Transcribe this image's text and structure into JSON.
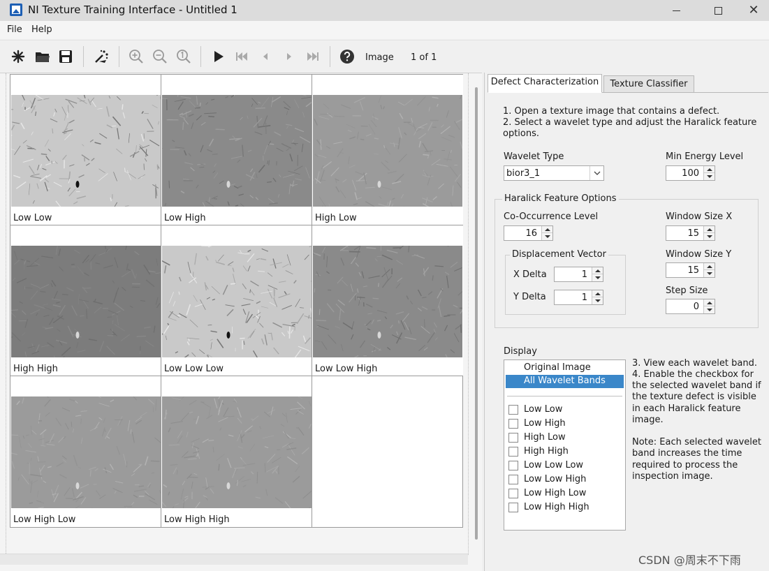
{
  "window": {
    "title": "NI Texture Training Interface - Untitled 1",
    "close_glyph": "✕"
  },
  "menu": {
    "file": "File",
    "help": "Help"
  },
  "toolbar": {
    "image_label": "Image",
    "page_indicator": "1  of   1",
    "icons": [
      "new-icon",
      "open-folder-icon",
      "save-icon",
      "magic-wand-icon",
      "zoom-in-icon",
      "zoom-out-icon",
      "zoom-fit-icon",
      "play-icon",
      "skip-first-icon",
      "step-back-icon",
      "step-forward-icon",
      "skip-last-icon",
      "help-icon"
    ]
  },
  "bands": [
    {
      "label": "Low Low",
      "tone": "light"
    },
    {
      "label": "Low High",
      "tone": "mid"
    },
    {
      "label": "High Low",
      "tone": "flat"
    },
    {
      "label": "High High",
      "tone": "dark"
    },
    {
      "label": "Low Low Low",
      "tone": "light"
    },
    {
      "label": "Low Low High",
      "tone": "mid"
    },
    {
      "label": "Low High Low",
      "tone": "flat"
    },
    {
      "label": "Low High High",
      "tone": "flat"
    }
  ],
  "tabs": {
    "defect": "Defect Characterization",
    "texture": "Texture Classifier"
  },
  "instructions": {
    "line1": "1. Open a texture image that contains a defect.",
    "line2": "2. Select a wavelet type and adjust the Haralick feature",
    "line3": "options."
  },
  "wavelet_type": {
    "label": "Wavelet Type",
    "value": "bior3_1"
  },
  "min_energy": {
    "label": "Min Energy Level",
    "value": "100"
  },
  "haralick": {
    "title": "Haralick Feature Options",
    "co_occurrence": {
      "label": "Co-Occurrence Level",
      "value": "16"
    },
    "window_x": {
      "label": "Window Size X",
      "value": "15"
    },
    "window_y": {
      "label": "Window Size Y",
      "value": "15"
    },
    "step_size": {
      "label": "Step Size",
      "value": "0"
    },
    "displacement": {
      "title": "Displacement Vector",
      "x_delta": {
        "label": "X Delta",
        "value": "1"
      },
      "y_delta": {
        "label": "Y Delta",
        "value": "1"
      }
    }
  },
  "display": {
    "label": "Display",
    "options": [
      "Original Image",
      "All Wavelet Bands"
    ],
    "selected_option": "All Wavelet Bands",
    "checkboxes": [
      "Low Low",
      "Low High",
      "High Low",
      "High High",
      "Low Low Low",
      "Low Low High",
      "Low High Low",
      "Low High High"
    ]
  },
  "help_text": {
    "p1_l1": "3. View each wavelet band.",
    "p1_l2": "4. Enable the checkbox for",
    "p1_l3": "the selected wavelet band if",
    "p1_l4": "the texture defect is visible",
    "p1_l5": "in each Haralick feature",
    "p1_l6": "image.",
    "p2_l1": "Note: Each selected wavelet",
    "p2_l2": "band increases the time",
    "p2_l3": "required to process the",
    "p2_l4": "inspection image."
  },
  "watermark": "CSDN @周末不下雨",
  "colors": {
    "selection": "#3a87c9",
    "app_icon": "#1e5fb4"
  }
}
